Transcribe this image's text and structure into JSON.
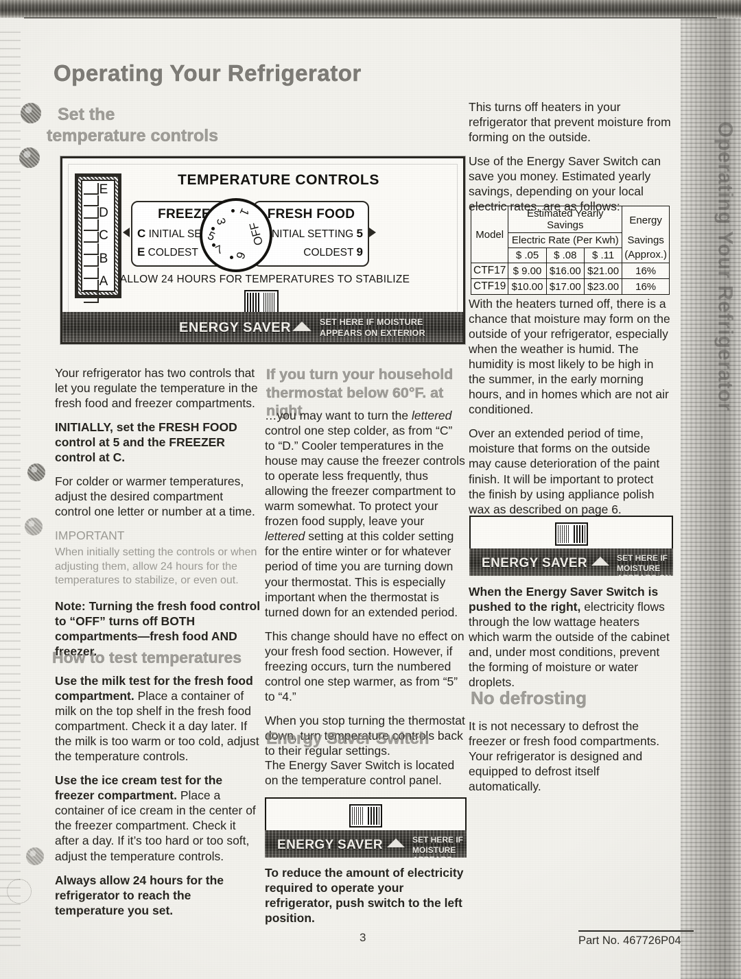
{
  "document": {
    "main_heading": "Operating Your Refrigerator",
    "section_heading_1": "Set the",
    "section_heading_1b": "temperature controls",
    "page_number": "3",
    "part_number": "Part No. 467726P04",
    "bleed_text": "Operating Your Refrigerator"
  },
  "panel": {
    "title": "TEMPERATURE CONTROLS",
    "slider_letters": [
      "E",
      "D",
      "C",
      "B",
      "A"
    ],
    "freezer": {
      "title": "FREEZER",
      "initial_letter": "C",
      "initial_label": "INITIAL SETTING",
      "coldest_letter": "E",
      "coldest_label": "COLDEST"
    },
    "fresh_food": {
      "title": "FRESH FOOD",
      "initial_label": "INITIAL SETTING",
      "initial_number": "5",
      "coldest_label": "COLDEST",
      "coldest_number": "9"
    },
    "dial_numbers": [
      "1",
      "3",
      "5",
      "7",
      "9"
    ],
    "dial_off": "OFF",
    "allow_note": "ALLOW 24 HOURS FOR TEMPERATURES TO STABILIZE",
    "energy_saver_label": "ENERGY SAVER",
    "energy_saver_note_1": "SET HERE IF MOISTURE",
    "energy_saver_note_2": "APPEARS ON EXTERIOR"
  },
  "left_column": {
    "p1": "Your refrigerator has two controls that let you regulate the temperature in the fresh food and freezer compartments.",
    "p2": "INITIALLY, set the FRESH FOOD control at 5 and the FREEZER control at C.",
    "p3": "For colder or warmer temperatures, adjust the desired compartment control one letter or number at a time.",
    "p4_title": "IMPORTANT",
    "p4": "When initially setting the controls or when adjusting them, allow 24 hours for the temperatures to stabilize, or even out.",
    "p5": "Note: Turning the fresh food control to “OFF” turns off BOTH compartments—fresh food AND freezer.",
    "heading_2": "How to test temperatures",
    "p6_bold": "Use the milk test for the fresh food compartment.",
    "p6_rest": " Place a container of milk on the top shelf in the fresh food compartment. Check it a day later. If the milk is too warm or too cold, adjust the temperature controls.",
    "p7_bold": "Use the ice cream test for the freezer compartment.",
    "p7_rest": " Place a container of ice cream in the center of the freezer compartment. Check it after a day. If it’s too hard or too soft, adjust the temperature controls.",
    "p8": "Always allow 24 hours for the refrigerator to reach the temperature you set."
  },
  "middle_column": {
    "heading_1a": "If you turn your household",
    "heading_1b": "thermostat below 60°F. at night",
    "p1_a": "…you may want to turn the ",
    "p1_i1": "lettered",
    "p1_b": " control one step colder, as from “C” to “D.” Cooler temperatures in the house may cause the freezer controls to operate less frequently, thus allowing the freezer compartment to warm somewhat. To protect your frozen food supply, leave your ",
    "p1_i2": "lettered",
    "p1_c": " setting at this colder setting for the entire winter or for whatever period of time you are turning down your thermostat. This is especially important when the thermostat is turned down for an extended period.",
    "p2": "This change should have no effect on your fresh food section. However, if freezing occurs, turn the numbered control one step warmer, as from “5” to “4.”",
    "p3": "When you stop turning the thermostat down, turn temperature controls back to their regular settings.",
    "heading_2": "Energy Saver Switch",
    "p4": "The Energy Saver Switch is located on the temperature control panel.",
    "p5": "To reduce the amount of electricity required to operate your refrigerator, push switch to the left position."
  },
  "right_column": {
    "p1": "This turns off heaters in your refrigerator that prevent moisture from forming on the outside.",
    "p2": "Use of the Energy Saver Switch can save you money. Estimated yearly savings, depending on your local electric rates, are as follows:",
    "p3": "With the heaters turned off, there is a chance that moisture may form on the outside of your refrigerator, especially when the weather is humid. The humidity is most likely to be high in the summer, in the early morning hours, and in homes which are not air conditioned.",
    "p4": "Over an extended period of time, moisture that forms on the outside may cause deterioration of the paint finish. It will be important to protect the finish by using appliance polish wax as described on page 6.",
    "p5_bold": "When the Energy Saver Switch is pushed to the right,",
    "p5_rest": " electricity flows through the low wattage heaters which warm the outside of the cabinet and, under most conditions, prevent the forming of moisture or water droplets.",
    "heading_2": "No defrosting",
    "p6": "It is not necessary to defrost the freezer or fresh food compartments. Your refrigerator is designed and equipped to defrost itself automatically."
  },
  "savings_table": {
    "col_model": "Model",
    "col_group": "Estimated Yearly Savings",
    "col_rate": "Electric Rate (Per Kwh)",
    "col_energy_1": "Energy",
    "col_energy_2": "Savings",
    "col_energy_3": "(Approx.)",
    "rates": [
      "$   .05",
      "$   .08",
      "$   .11"
    ],
    "rows": [
      {
        "model": "CTF17",
        "values": [
          "$  9.00",
          "$16.00",
          "$21.00"
        ],
        "savings": "16%"
      },
      {
        "model": "CTF19",
        "values": [
          "$10.00",
          "$17.00",
          "$23.00"
        ],
        "savings": "16%"
      }
    ]
  }
}
